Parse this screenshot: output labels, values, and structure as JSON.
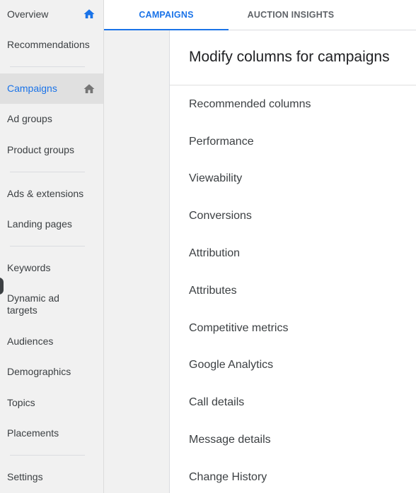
{
  "sidebar": {
    "items": [
      {
        "label": "Overview"
      },
      {
        "label": "Recommendations"
      },
      {
        "label": "Campaigns"
      },
      {
        "label": "Ad groups"
      },
      {
        "label": "Product groups"
      },
      {
        "label": "Ads & extensions"
      },
      {
        "label": "Landing pages"
      },
      {
        "label": "Keywords"
      },
      {
        "label": "Dynamic ad targets"
      },
      {
        "label": "Audiences"
      },
      {
        "label": "Demographics"
      },
      {
        "label": "Topics"
      },
      {
        "label": "Placements"
      },
      {
        "label": "Settings"
      }
    ],
    "active": "Campaigns"
  },
  "tabs": [
    {
      "label": "CAMPAIGNS",
      "active": true
    },
    {
      "label": "AUCTION INSIGHTS",
      "active": false
    }
  ],
  "panel": {
    "title": "Modify columns for campaigns",
    "columns": [
      "Recommended columns",
      "Performance",
      "Viewability",
      "Conversions",
      "Attribution",
      "Attributes",
      "Competitive metrics",
      "Google Analytics",
      "Call details",
      "Message details",
      "Change History"
    ]
  },
  "colors": {
    "accent": "#1a73e8",
    "sidebar_bg": "#f1f1f1",
    "active_bg": "#e0e0e0",
    "text": "#3c4043"
  },
  "icons": {
    "overview_home": "home-icon",
    "campaigns_home": "home-icon"
  }
}
